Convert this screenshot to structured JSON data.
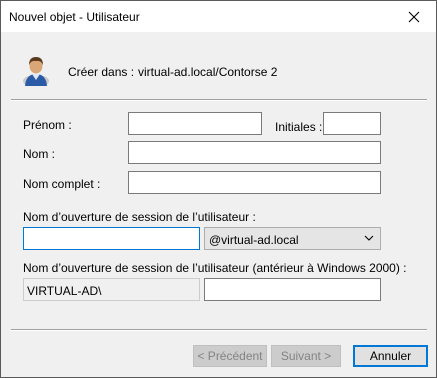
{
  "window": {
    "title": "Nouvel objet - Utilisateur"
  },
  "header": {
    "create_in_label": "Créer dans :",
    "create_in_value": "virtual-ad.local/Contorse 2"
  },
  "form": {
    "first_name_label": "Prénom :",
    "first_name_value": "",
    "initials_label": "Initiales :",
    "initials_value": "",
    "last_name_label": "Nom :",
    "last_name_value": "",
    "full_name_label": "Nom complet :",
    "full_name_value": "",
    "logon_label": "Nom d’ouverture de session de l’utilisateur :",
    "logon_value": "",
    "logon_domain_selected": "@virtual-ad.local",
    "logon_pre2000_label": "Nom d’ouverture de session de l’utilisateur (antérieur à Windows 2000) :",
    "logon_pre2000_domain": "VIRTUAL-AD\\",
    "logon_pre2000_value": ""
  },
  "buttons": {
    "previous": "< Précédent",
    "next": "Suivant >",
    "cancel": "Annuler"
  }
}
